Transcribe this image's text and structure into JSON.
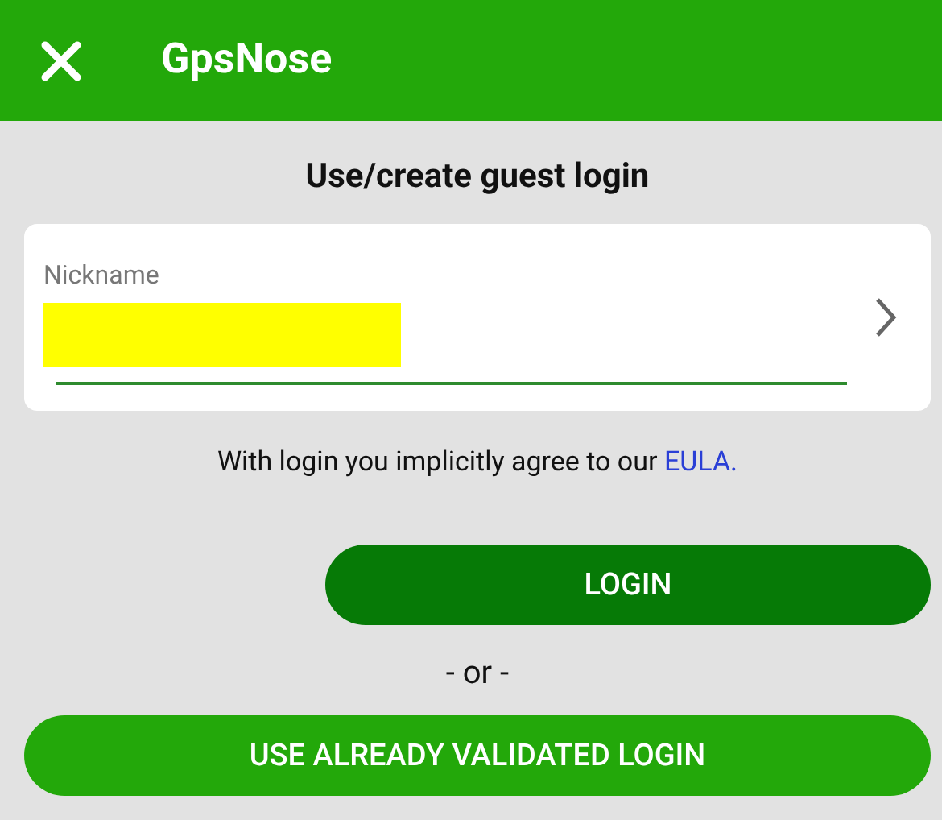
{
  "header": {
    "title": "GpsNose"
  },
  "heading": "Use/create guest login",
  "nickname_field": {
    "label": "Nickname",
    "redacted": true
  },
  "agreement": {
    "text": "With login you implicitly agree to our ",
    "link": "EULA."
  },
  "login_button": "LOGIN",
  "separator": "- or -",
  "validated_button": "USE ALREADY VALIDATED LOGIN"
}
